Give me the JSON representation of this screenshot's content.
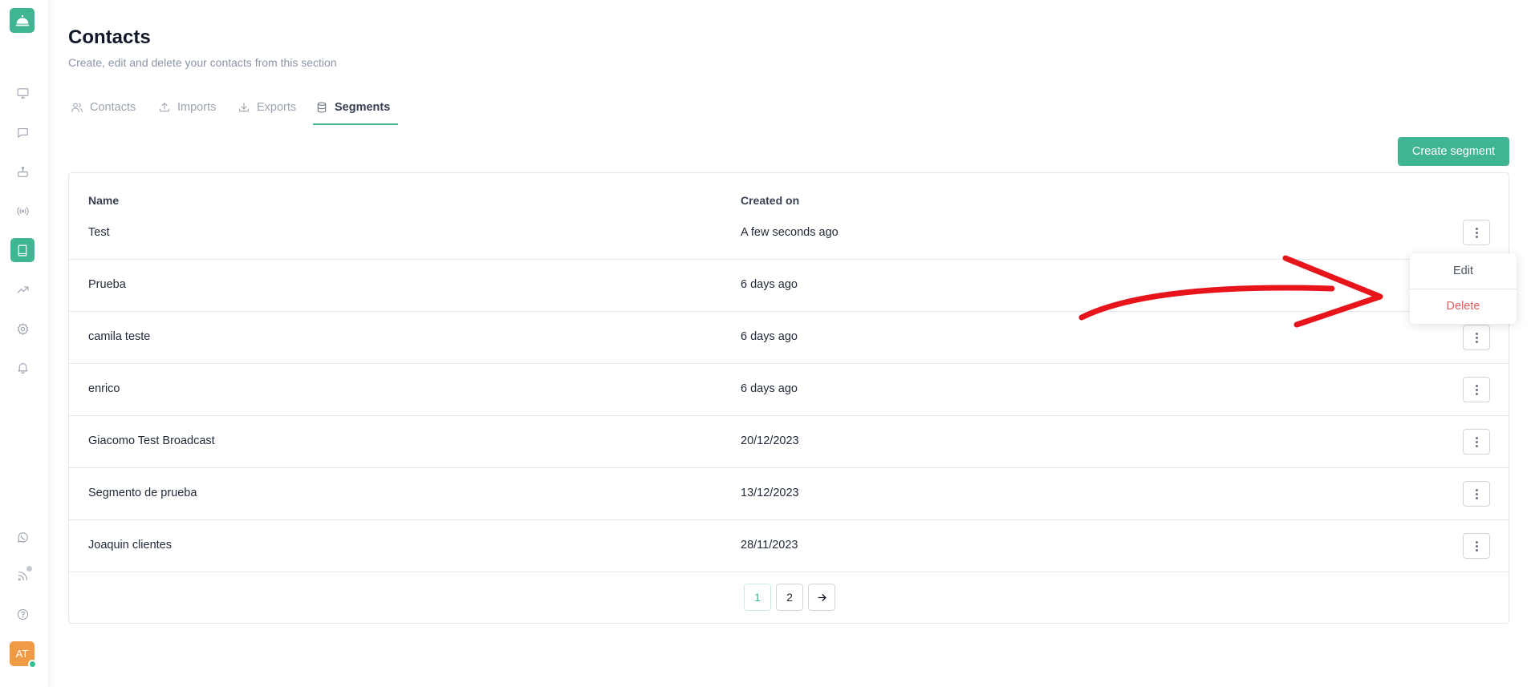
{
  "header": {
    "title": "Contacts",
    "subtitle": "Create, edit and delete your contacts from this section"
  },
  "sidebar": {
    "logo_icon": "bell-service-icon",
    "items": [
      {
        "icon": "monitor-icon"
      },
      {
        "icon": "chat-icon"
      },
      {
        "icon": "bot-icon"
      },
      {
        "icon": "broadcast-icon"
      },
      {
        "icon": "book-icon",
        "active": true
      },
      {
        "icon": "trending-icon"
      },
      {
        "icon": "gear-icon"
      },
      {
        "icon": "bell-icon"
      }
    ],
    "bottom_items": [
      {
        "icon": "whatsapp-icon"
      },
      {
        "icon": "rss-icon"
      },
      {
        "icon": "help-icon"
      }
    ],
    "avatar_initials": "AT"
  },
  "tabs": [
    {
      "label": "Contacts",
      "icon": "users-icon"
    },
    {
      "label": "Imports",
      "icon": "upload-icon"
    },
    {
      "label": "Exports",
      "icon": "download-icon"
    },
    {
      "label": "Segments",
      "icon": "database-icon",
      "active": true
    }
  ],
  "toolbar": {
    "create_label": "Create segment"
  },
  "table": {
    "columns": {
      "name": "Name",
      "created_on": "Created on"
    },
    "rows": [
      {
        "name": "Test",
        "created_on": "A few seconds ago"
      },
      {
        "name": "Prueba",
        "created_on": "6 days ago"
      },
      {
        "name": "camila teste",
        "created_on": "6 days ago"
      },
      {
        "name": "enrico",
        "created_on": "6 days ago"
      },
      {
        "name": "Giacomo Test Broadcast",
        "created_on": "20/12/2023"
      },
      {
        "name": "Segmento de prueba",
        "created_on": "13/12/2023"
      },
      {
        "name": "Joaquin clientes",
        "created_on": "28/11/2023"
      }
    ]
  },
  "pagination": {
    "pages": [
      "1",
      "2"
    ],
    "current": "1",
    "next_icon": "arrow-right-icon"
  },
  "row_menu": {
    "edit_label": "Edit",
    "delete_label": "Delete"
  },
  "colors": {
    "accent": "#3fb594",
    "danger": "#e05d5d",
    "annotation": "#e8141c",
    "avatar": "#ef9b45"
  }
}
